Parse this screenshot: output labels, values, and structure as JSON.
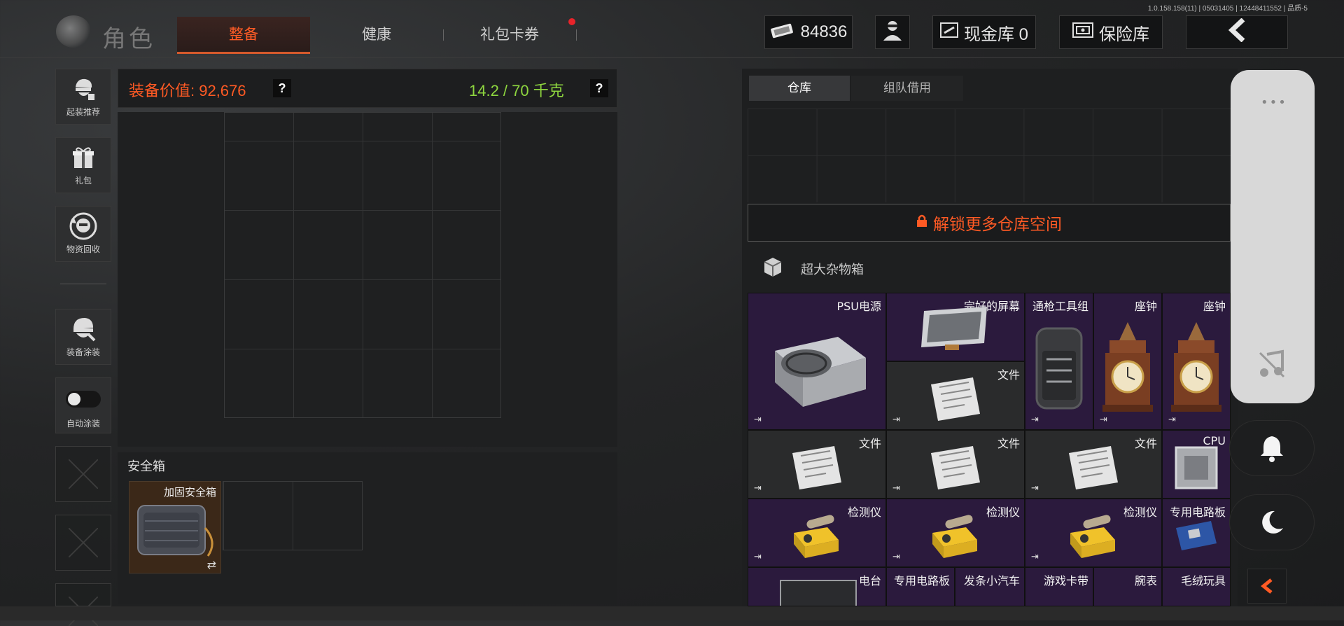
{
  "version": "1.0.158.158(11) | 05031405 | 12448411552 | 品质-5",
  "header": {
    "title": "角色",
    "tabs": [
      {
        "label": "整备",
        "active": true
      },
      {
        "label": "健康",
        "active": false
      },
      {
        "label": "礼包卡券",
        "active": false,
        "badge": true
      }
    ],
    "money": "84836",
    "cash_vault": "现金库 0",
    "insurance": "保险库",
    "back_icon": "chevron-left-icon"
  },
  "sidebar": [
    {
      "label": "起装推荐",
      "icon": "soldier-icon"
    },
    {
      "label": "礼包",
      "icon": "gift-icon"
    },
    {
      "label": "物资回收",
      "icon": "recycle-icon"
    },
    {
      "label": "装备涂装",
      "icon": "helmet-icon"
    },
    {
      "label": "自动涂装",
      "icon": "toggle-icon"
    }
  ],
  "equipment": {
    "value_label": "装备价值: 92,676",
    "weight_label": "14.2 / 70 千克",
    "help": "?"
  },
  "safe_box": {
    "title": "安全箱",
    "item_name": "加固安全箱",
    "swap_icon": "⇄"
  },
  "storage": {
    "tabs": [
      {
        "label": "仓库",
        "active": true
      },
      {
        "label": "组队借用",
        "active": false
      }
    ],
    "unlock_label": "解锁更多仓库空间",
    "box_label": "超大杂物箱",
    "items": [
      {
        "name": "PSU电源",
        "rarity": "purple"
      },
      {
        "name": "完好的屏幕",
        "rarity": "purple"
      },
      {
        "name": "通枪工具组",
        "rarity": "purple"
      },
      {
        "name": "座钟",
        "rarity": "purple"
      },
      {
        "name": "座钟",
        "rarity": "purple"
      },
      {
        "name": "文件",
        "rarity": "gray"
      },
      {
        "name": "文件",
        "rarity": "gray"
      },
      {
        "name": "文件",
        "rarity": "gray"
      },
      {
        "name": "文件",
        "rarity": "gray"
      },
      {
        "name": "CPU",
        "rarity": "purple"
      },
      {
        "name": "检测仪",
        "rarity": "purple"
      },
      {
        "name": "检测仪",
        "rarity": "purple"
      },
      {
        "name": "检测仪",
        "rarity": "purple"
      },
      {
        "name": "专用电路板",
        "rarity": "purple"
      },
      {
        "name": "电台",
        "rarity": "purple"
      },
      {
        "name": "专用电路板",
        "rarity": "purple"
      },
      {
        "name": "发条小汽车",
        "rarity": "purple"
      },
      {
        "name": "游戏卡带",
        "rarity": "purple"
      },
      {
        "name": "腕表",
        "rarity": "purple"
      },
      {
        "name": "毛绒玩具",
        "rarity": "purple"
      }
    ],
    "extract_icon": "⇥"
  },
  "overlay": {
    "menu_dots": "•••",
    "music_icon": "music-off-icon",
    "bell_icon": "bell-icon",
    "moon_icon": "moon-icon"
  }
}
